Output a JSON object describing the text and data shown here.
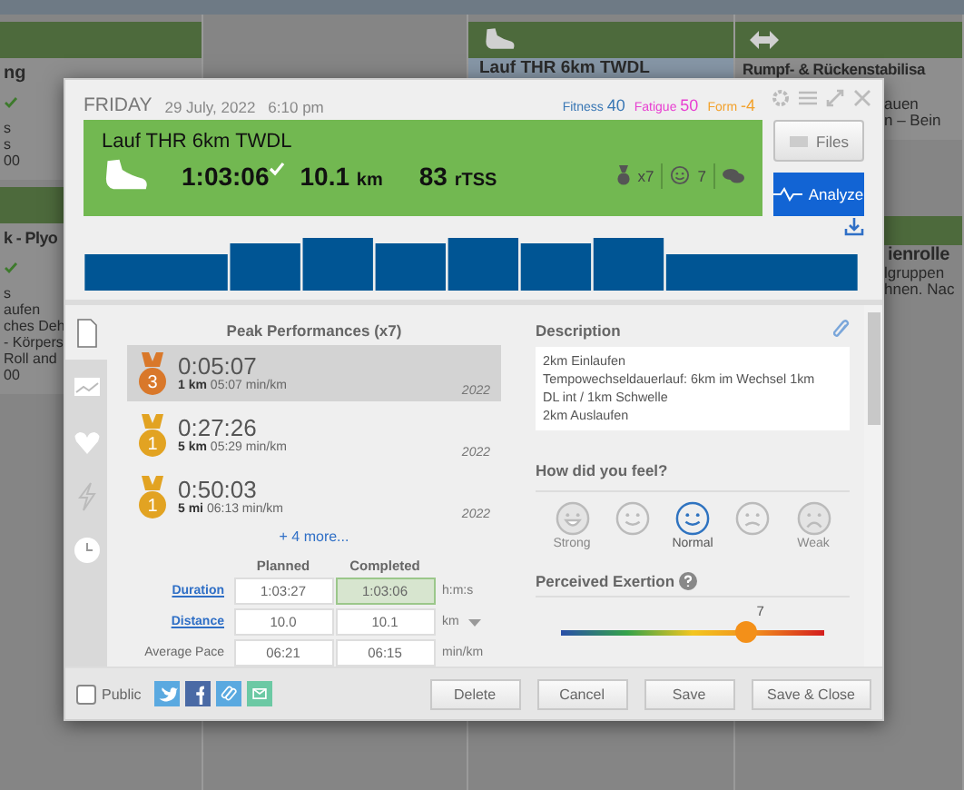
{
  "calendar": {
    "column_1": [
      {
        "title": "ng",
        "completed": true,
        "lines": [
          "s",
          "s",
          "00"
        ]
      },
      {
        "title": "k - Plyo",
        "completed": true,
        "lines": [
          "s",
          "aufen",
          "ches Deh",
          "- Körpers",
          "Roll and",
          "00"
        ]
      }
    ],
    "column_3": [
      {
        "title": "Lauf THR 6km TWDL",
        "kind": "run",
        "selected": true
      }
    ],
    "column_4": [
      {
        "title": "Rumpf- & Rückenstabilisa",
        "kind": "strength",
        "lines": [
          "auen",
          "n – Bein"
        ]
      },
      {
        "title": "ienrolle",
        "lines": [
          "lgruppen",
          "hnen. Nac"
        ]
      }
    ]
  },
  "dialog": {
    "day": "FRIDAY",
    "date": "29 July, 2022",
    "time": "6:10 pm",
    "metrics": [
      {
        "label": "Fitness",
        "value": "40",
        "color": "#3a78b5"
      },
      {
        "label": "Fatigue",
        "value": "50",
        "color": "#e83fd1"
      },
      {
        "label": "Form",
        "value": "-4",
        "color": "#f2a12b"
      }
    ],
    "workout": {
      "title": "Lauf THR 6km TWDL",
      "duration": "1:03:06",
      "completed": true,
      "distance": "10.1",
      "distance_unit": "km",
      "tss": "83",
      "tss_unit": "rTSS",
      "peaks": "x7",
      "feeling": "7"
    },
    "buttons": {
      "files": "Files",
      "analyze": "Analyze"
    },
    "side_tabs": [
      {
        "kind": "document",
        "selected": true
      },
      {
        "kind": "chart",
        "selected": false
      },
      {
        "kind": "heart",
        "selected": false
      },
      {
        "kind": "bolt",
        "selected": false
      },
      {
        "kind": "clock",
        "selected": false
      }
    ],
    "peak_performances": {
      "title": "Peak Performances (x7)",
      "items": [
        {
          "rank": "3",
          "color": "#d9782a",
          "time": "0:05:07",
          "distance": "1 km",
          "pace": "05:07 min/km",
          "year": "2022",
          "selected": true
        },
        {
          "rank": "1",
          "color": "#e2a322",
          "time": "0:27:26",
          "distance": "5 km",
          "pace": "05:29 min/km",
          "year": "2022",
          "selected": false
        },
        {
          "rank": "1",
          "color": "#e2a322",
          "time": "0:50:03",
          "distance": "5 mi",
          "pace": "06:13 min/km",
          "year": "2022",
          "selected": false
        }
      ],
      "more": "+ 4 more..."
    },
    "summary": {
      "columns": [
        "Planned",
        "Completed"
      ],
      "rows": [
        {
          "label": "Duration",
          "link": true,
          "planned": "1:03:27",
          "completed": "1:03:06",
          "unit": "h:m:s",
          "dropdown": false
        },
        {
          "label": "Distance",
          "link": true,
          "planned": "10.0",
          "completed": "10.1",
          "unit": "km",
          "dropdown": true
        },
        {
          "label": "Average Pace",
          "link": false,
          "planned": "06:21",
          "completed": "06:15",
          "unit": "min/km",
          "dropdown": false
        }
      ]
    },
    "description": {
      "label": "Description",
      "text": "2km Einlaufen\nTempowechseldauerlauf: 6km im Wechsel 1km\nDL int / 1km Schwelle\n2km Auslaufen"
    },
    "feel": {
      "label": "How did you feel?",
      "options": [
        {
          "kind": "very-happy",
          "label": "Strong",
          "selected": false
        },
        {
          "kind": "happy",
          "selected": false
        },
        {
          "kind": "neutral",
          "label": "Normal",
          "selected": true
        },
        {
          "kind": "sad",
          "selected": false
        },
        {
          "kind": "very-sad",
          "label": "Weak",
          "selected": false
        }
      ]
    },
    "exertion": {
      "label": "Perceived Exertion",
      "value": "7",
      "level": 0.7
    },
    "footer": {
      "public_label": "Public",
      "public": false,
      "share": [
        {
          "kind": "twitter",
          "color": "#5aa9e0"
        },
        {
          "kind": "facebook",
          "color": "#4a6aa5"
        },
        {
          "kind": "link",
          "color": "#5aa9e0"
        },
        {
          "kind": "email",
          "color": "#6cc9a4"
        }
      ],
      "buttons": [
        "Delete",
        "Cancel",
        "Save",
        "Save & Close"
      ]
    }
  }
}
